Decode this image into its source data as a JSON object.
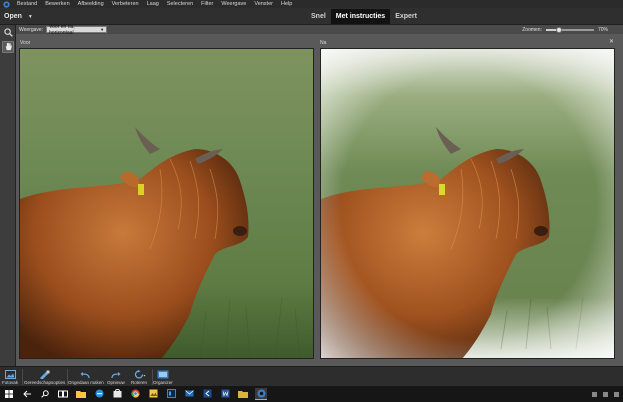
{
  "menubar": {
    "items": [
      "Bestand",
      "Bewerken",
      "Afbeelding",
      "Verbeteren",
      "Laag",
      "Selecteren",
      "Filter",
      "Weergave",
      "Venster",
      "Help"
    ]
  },
  "modebar": {
    "open_label": "Open",
    "tabs": [
      {
        "label": "Snel",
        "active": false
      },
      {
        "label": "Met instructies",
        "active": true
      },
      {
        "label": "Expert",
        "active": false
      }
    ]
  },
  "options": {
    "view_label": "Weergave:",
    "view_value": "Voor en na, horizontaal",
    "zoom_label": "Zoomen:",
    "zoom_value": "70%",
    "zoom_fraction": 0.28
  },
  "panes": {
    "before_label": "Voor",
    "after_label": "Na"
  },
  "bottom": {
    "buttons": [
      "Fotovak",
      "Gereedschapsopties",
      "Ongedaan maken",
      "Opnieuw",
      "Roteren",
      "Organizer"
    ]
  },
  "colors": {
    "accent": "#121212",
    "photo_grass": "#6f8a55",
    "fur": "#a0521f"
  },
  "icons": {
    "tools": [
      "zoom-icon",
      "hand-icon"
    ],
    "taskbar": [
      "windows-icon",
      "search-icon",
      "task-view-icon",
      "edge-icon",
      "explorer-icon",
      "store-icon",
      "chrome-icon",
      "photos-icon",
      "photoshop-icon",
      "mail-icon",
      "vscode-icon",
      "word-icon",
      "folder-icon",
      "elements-icon"
    ]
  }
}
